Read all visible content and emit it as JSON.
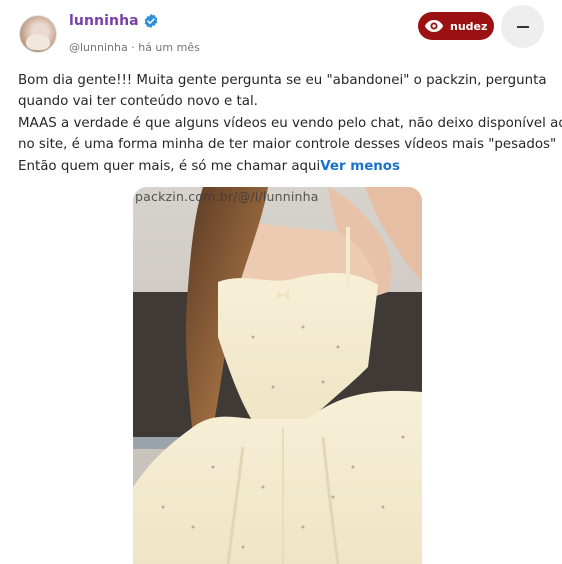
{
  "post": {
    "username": "lunninha",
    "handle": "@lunninha",
    "separator": "·",
    "time": "há um mês",
    "badge_label": "nudez",
    "lines": [
      "Bom dia gente!!! Muita gente pergunta se eu \"abandonei\" o packzin, pergunta",
      "quando vai ter conteúdo novo e tal.",
      "MAAS a verdade é que alguns vídeos eu vendo pelo chat, não deixo disponível aqui",
      "no site, é uma forma minha de ter maior controle desses vídeos mais \"pesados\"",
      "Então quem quer mais, é só me chamar aqui"
    ],
    "see_less": "Ver menos",
    "watermark": "packzin.com.br/@/l/lunninha"
  },
  "colors": {
    "username": "#7a3ea8",
    "verified": "#2f8fd8",
    "badge": "#9b1111",
    "link": "#1a73c8"
  },
  "icons": {
    "verified": "verified-badge-icon",
    "badge": "eye-icon",
    "more": "minus-icon"
  }
}
